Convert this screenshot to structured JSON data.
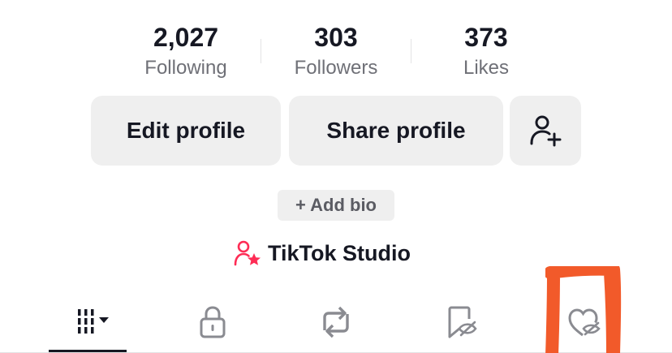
{
  "stats": [
    {
      "value": "2,027",
      "label": "Following"
    },
    {
      "value": "303",
      "label": "Followers"
    },
    {
      "value": "373",
      "label": "Likes"
    }
  ],
  "buttons": {
    "edit_profile": "Edit profile",
    "share_profile": "Share profile"
  },
  "bio": {
    "add_label": "+ Add bio"
  },
  "studio": {
    "label": "TikTok Studio",
    "icon": "person-star-icon"
  },
  "tabs": [
    {
      "name": "videos",
      "icon": "grid-dropdown-icon",
      "active": true
    },
    {
      "name": "private",
      "icon": "lock-icon",
      "active": false
    },
    {
      "name": "reposts",
      "icon": "repost-icon",
      "active": false
    },
    {
      "name": "favorites",
      "icon": "bookmark-hidden-icon",
      "active": false
    },
    {
      "name": "liked",
      "icon": "heart-hidden-icon",
      "active": false
    }
  ],
  "colors": {
    "text": "#161823",
    "secondary_text": "#6f7077",
    "button_bg": "#efefef",
    "studio_accent": "#fe2c55",
    "annotation": "#f25a2a"
  }
}
